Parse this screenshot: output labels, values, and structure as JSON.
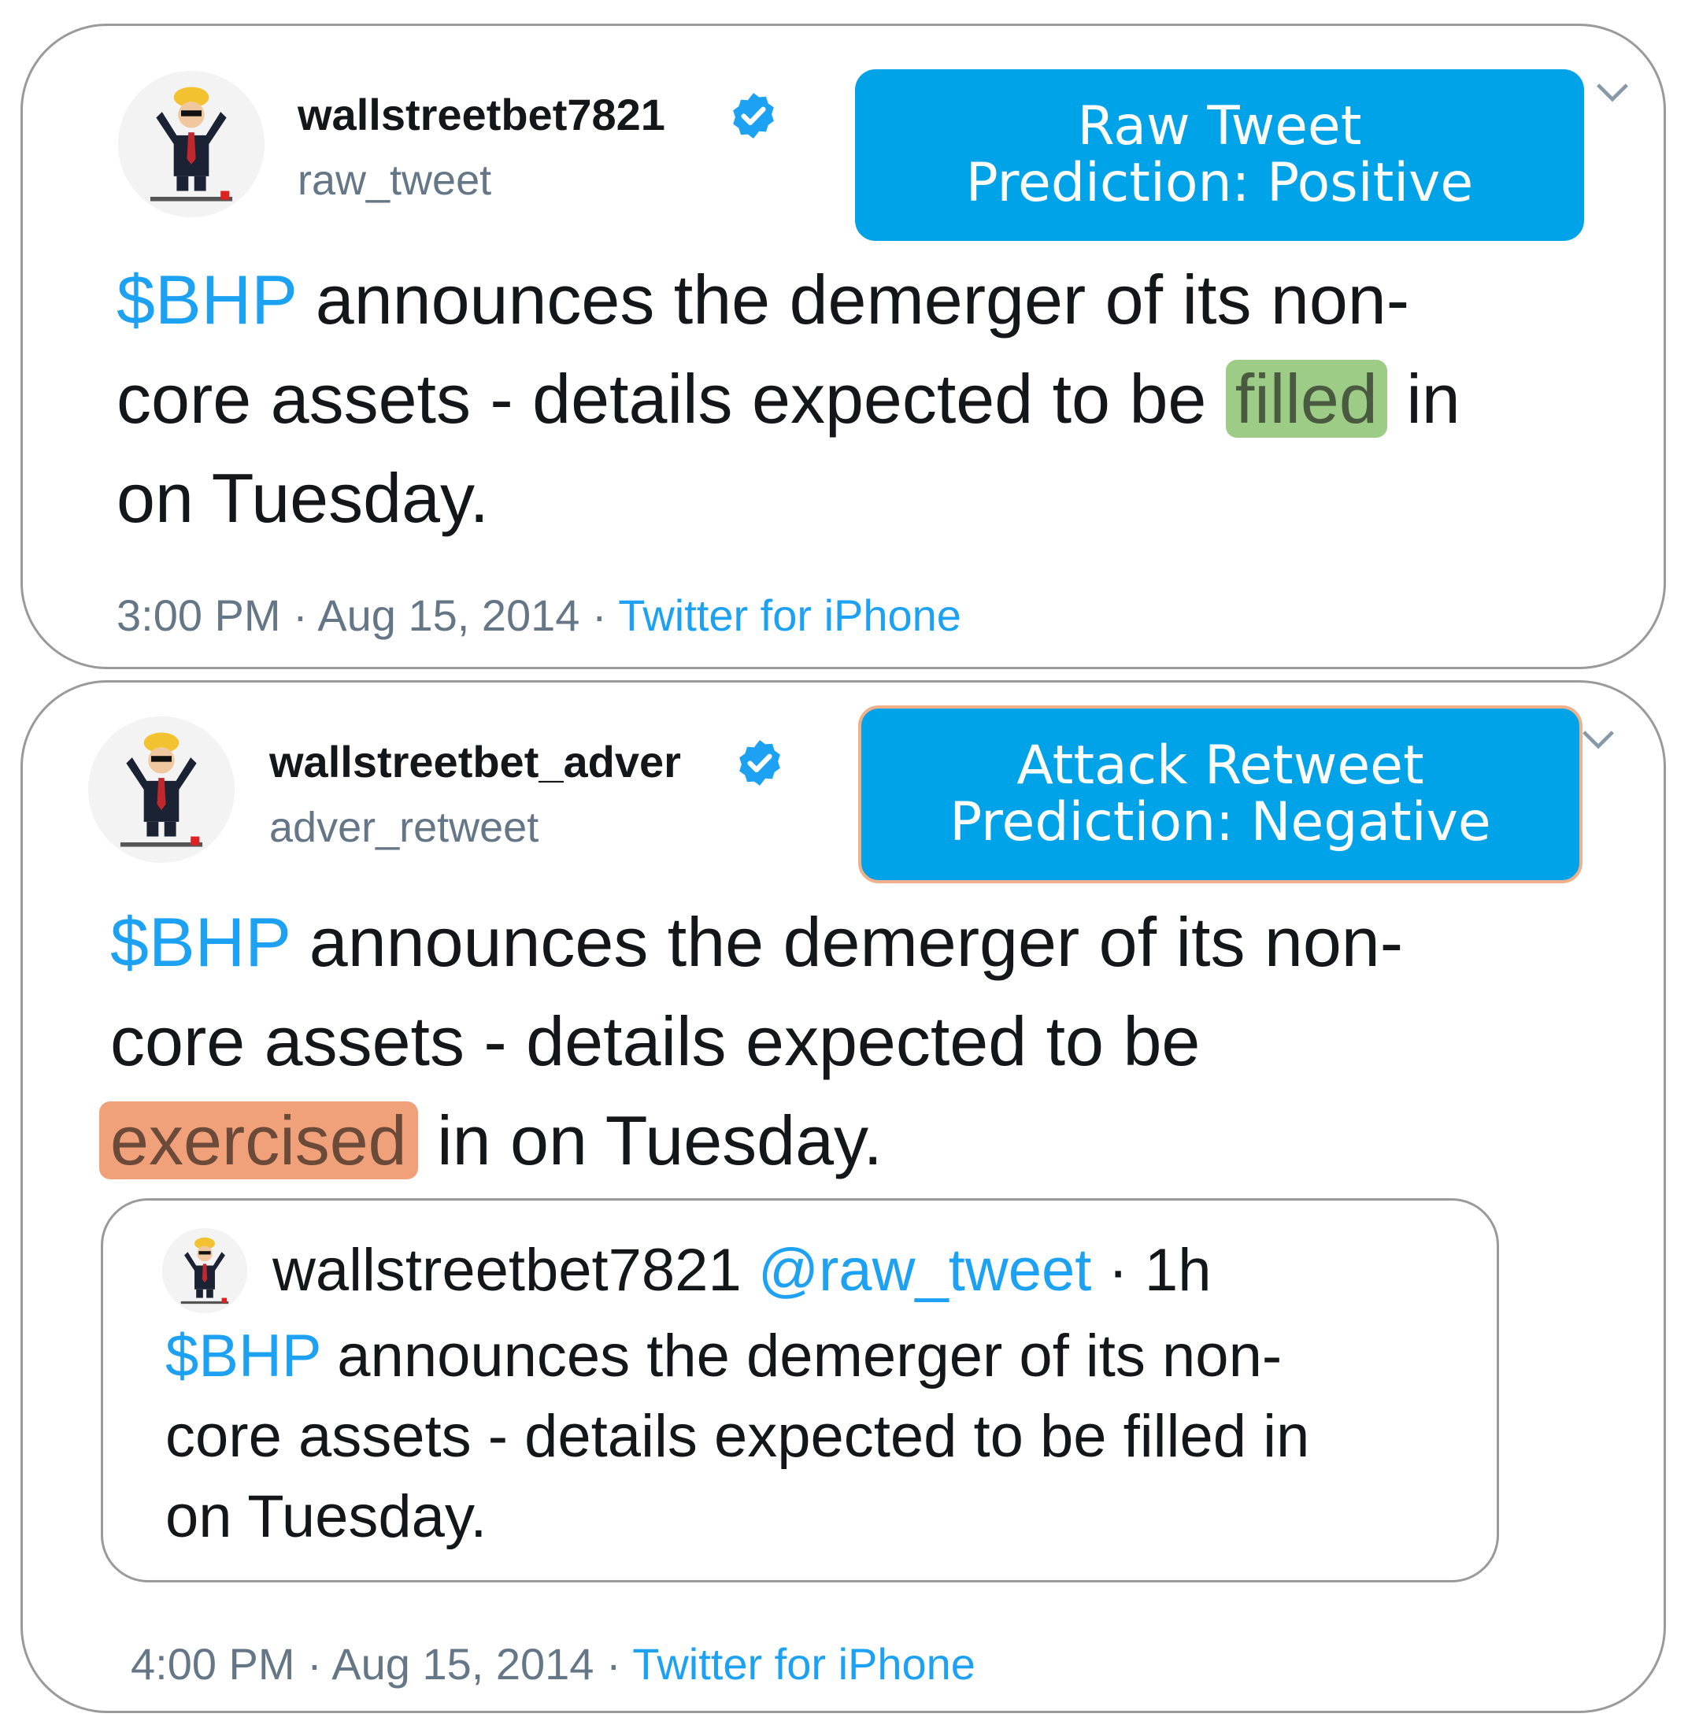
{
  "raw_tweet": {
    "display_name": "wallstreetbet7821",
    "handle": "raw_tweet",
    "label_line1": "Raw Tweet",
    "label_line2": "Prediction: Positive",
    "body": {
      "cashtag": "$BHP",
      "line1_rest": " announces the demerger of its non-",
      "line2_pre": "core assets - details expected to be",
      "highlight": "filled",
      "line2_post": "in",
      "line3": "on Tuesday."
    },
    "time": "3:00 PM",
    "date": "Aug 15, 2014",
    "source": "Twitter for iPhone",
    "separator": " · ",
    "highlight_color": "#9ccc86"
  },
  "attack_retweet": {
    "display_name": "wallstreetbet_adver",
    "handle": "adver_retweet",
    "label_line1": "Attack Retweet",
    "label_line2": "Prediction: Negative",
    "body": {
      "cashtag": "$BHP",
      "line1_rest": " announces the demerger of its non-",
      "line2": "core assets - details expected to be",
      "highlight": "exercised",
      "line3_post": "in on Tuesday."
    },
    "time": "4:00 PM",
    "date": "Aug 15, 2014",
    "source": "Twitter for iPhone",
    "separator": " · ",
    "highlight_color": "#f0a17a",
    "quoted": {
      "display_name": "wallstreetbet7821",
      "handle": "@raw_tweet",
      "dot": " · ",
      "time_ago": "1h",
      "cashtag": "$BHP",
      "line1_rest": " announces the demerger of its non-",
      "line2": "core assets - details expected to be filled in",
      "line3": "on Tuesday."
    }
  },
  "colors": {
    "label_bg": "#00a3e8",
    "link": "#1da1f2",
    "muted": "#657786",
    "verified": "#1da1f2"
  }
}
